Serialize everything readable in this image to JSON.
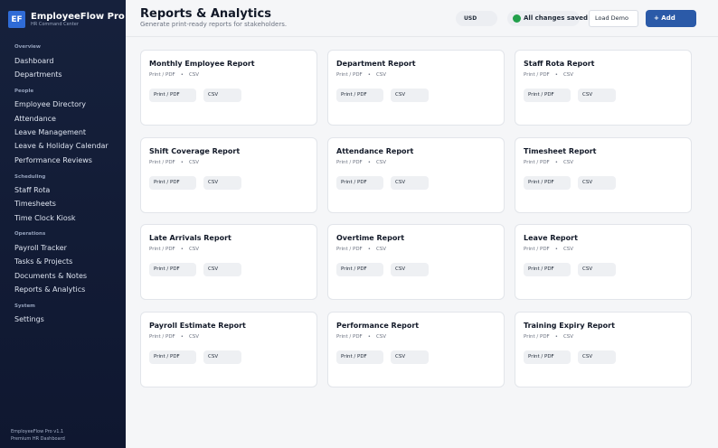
{
  "brand": {
    "logo": "EF",
    "name": "EmployeeFlow Pro",
    "subtitle": "HR Command Center"
  },
  "sidebar": {
    "sections": [
      {
        "label": "Overview",
        "items": [
          "Dashboard",
          "Departments"
        ]
      },
      {
        "label": "People",
        "items": [
          "Employee Directory",
          "Attendance",
          "Leave Management",
          "Leave & Holiday Calendar",
          "Performance Reviews"
        ]
      },
      {
        "label": "Scheduling",
        "items": [
          "Staff Rota",
          "Timesheets",
          "Time Clock Kiosk"
        ]
      },
      {
        "label": "Operations",
        "items": [
          "Payroll Tracker",
          "Tasks & Projects",
          "Documents & Notes",
          "Reports & Analytics"
        ]
      },
      {
        "label": "System",
        "items": [
          "Settings"
        ]
      }
    ],
    "footer": {
      "version": "EmployeeFlow Pro v1.1",
      "tagline": "Premium HR Dashboard"
    }
  },
  "header": {
    "title": "Reports & Analytics",
    "subtitle": "Generate print-ready reports for stakeholders.",
    "currency": "USD",
    "save_status": "All changes saved",
    "load_demo_label": "Load Demo",
    "add_label": "+ Add"
  },
  "cards": [
    {
      "title": "Monthly Employee Report",
      "formats": [
        "Print / PDF",
        "CSV"
      ],
      "buttons": [
        "Print / PDF",
        "CSV"
      ]
    },
    {
      "title": "Department Report",
      "formats": [
        "Print / PDF",
        "CSV"
      ],
      "buttons": [
        "Print / PDF",
        "CSV"
      ]
    },
    {
      "title": "Staff Rota Report",
      "formats": [
        "Print / PDF",
        "CSV"
      ],
      "buttons": [
        "Print / PDF",
        "CSV"
      ]
    },
    {
      "title": "Shift Coverage Report",
      "formats": [
        "Print / PDF",
        "CSV"
      ],
      "buttons": [
        "Print / PDF",
        "CSV"
      ]
    },
    {
      "title": "Attendance Report",
      "formats": [
        "Print / PDF",
        "CSV"
      ],
      "buttons": [
        "Print / PDF",
        "CSV"
      ]
    },
    {
      "title": "Timesheet Report",
      "formats": [
        "Print / PDF",
        "CSV"
      ],
      "buttons": [
        "Print / PDF",
        "CSV"
      ]
    },
    {
      "title": "Late Arrivals Report",
      "formats": [
        "Print / PDF",
        "CSV"
      ],
      "buttons": [
        "Print / PDF",
        "CSV"
      ]
    },
    {
      "title": "Overtime Report",
      "formats": [
        "Print / PDF",
        "CSV"
      ],
      "buttons": [
        "Print / PDF",
        "CSV"
      ]
    },
    {
      "title": "Leave Report",
      "formats": [
        "Print / PDF",
        "CSV"
      ],
      "buttons": [
        "Print / PDF",
        "CSV"
      ]
    },
    {
      "title": "Payroll Estimate Report",
      "formats": [
        "Print / PDF",
        "CSV"
      ],
      "buttons": [
        "Print / PDF",
        "CSV"
      ]
    },
    {
      "title": "Performance Report",
      "formats": [
        "Print / PDF",
        "CSV"
      ],
      "buttons": [
        "Print / PDF",
        "CSV"
      ]
    },
    {
      "title": "Training Expiry Report",
      "formats": [
        "Print / PDF",
        "CSV"
      ],
      "buttons": [
        "Print / PDF",
        "CSV"
      ]
    }
  ],
  "colors": {
    "sidebar_bg": "#16213c",
    "accent": "#2b5aa8",
    "saved_dot": "#22a04b"
  },
  "icons": {
    "save_status": "status-dot-icon"
  }
}
